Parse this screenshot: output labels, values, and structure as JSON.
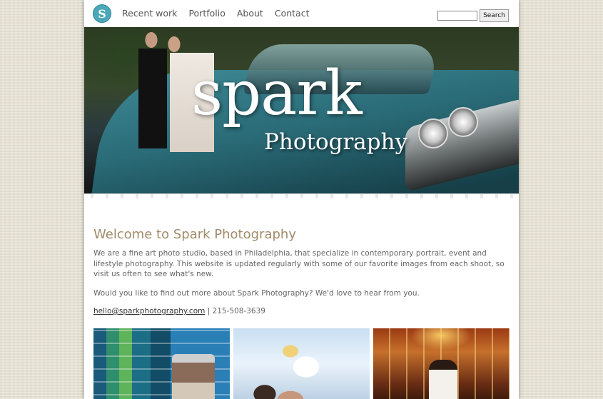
{
  "header": {
    "logo_letter": "S",
    "nav": [
      "Recent work",
      "Portfolio",
      "About",
      "Contact"
    ],
    "search": {
      "value": "",
      "button_label": "Search"
    }
  },
  "hero": {
    "title": "spark",
    "subtitle": "Photography"
  },
  "main": {
    "heading": "Welcome to Spark Photography",
    "intro": "We are a fine art photo studio, based in Philadelphia, that specialize in contemporary portrait, event and lifestyle photography. This website is updated regularly with some of our favorite images from each shoot, so visit us often to see what's new.",
    "question": "Would you like to find out more about Spark Photography? We'd love to hear from you.",
    "email": "hello@sparkphotography.com",
    "separator": "|",
    "phone": "215-508-3639"
  },
  "colors": {
    "heading": "#a08b6a",
    "logo": "#4aa8b8",
    "body_text": "#666666"
  }
}
